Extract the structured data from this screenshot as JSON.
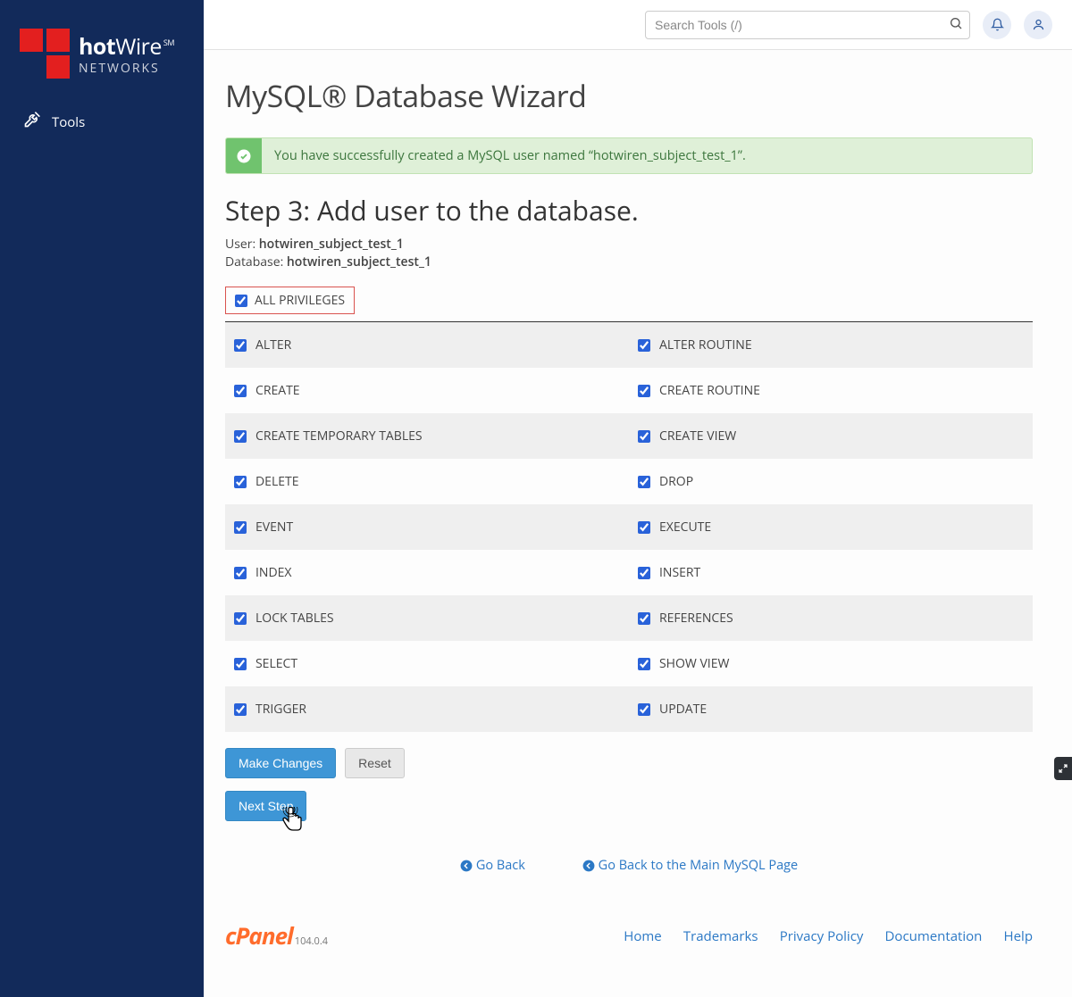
{
  "sidebar": {
    "brand_prefix": "hot",
    "brand_suffix": "Wire",
    "brand_sub": "NETWORKS",
    "brand_mark": "SM",
    "items": [
      {
        "label": "Tools",
        "icon": "tools-icon"
      }
    ]
  },
  "header": {
    "search_placeholder": "Search Tools (/)"
  },
  "page": {
    "title": "MySQL® Database Wizard"
  },
  "alert": {
    "text": "You have successfully created a MySQL user named “hotwiren_subject_test_1”."
  },
  "step": {
    "title": "Step 3: Add user to the database.",
    "user_label": "User:",
    "user_value": "hotwiren_subject_test_1",
    "db_label": "Database:",
    "db_value": "hotwiren_subject_test_1"
  },
  "all_privileges_label": "ALL PRIVILEGES",
  "privileges": [
    {
      "left": "ALTER",
      "right": "ALTER ROUTINE"
    },
    {
      "left": "CREATE",
      "right": "CREATE ROUTINE"
    },
    {
      "left": "CREATE TEMPORARY TABLES",
      "right": "CREATE VIEW"
    },
    {
      "left": "DELETE",
      "right": "DROP"
    },
    {
      "left": "EVENT",
      "right": "EXECUTE"
    },
    {
      "left": "INDEX",
      "right": "INSERT"
    },
    {
      "left": "LOCK TABLES",
      "right": "REFERENCES"
    },
    {
      "left": "SELECT",
      "right": "SHOW VIEW"
    },
    {
      "left": "TRIGGER",
      "right": "UPDATE"
    }
  ],
  "buttons": {
    "make_changes": "Make Changes",
    "reset": "Reset",
    "next_step": "Next Step"
  },
  "backlinks": {
    "go_back": "Go Back",
    "go_back_main": "Go Back to the Main MySQL Page"
  },
  "footer": {
    "logo": "cPanel",
    "version": "104.0.4",
    "links": [
      "Home",
      "Trademarks",
      "Privacy Policy",
      "Documentation",
      "Help"
    ]
  }
}
